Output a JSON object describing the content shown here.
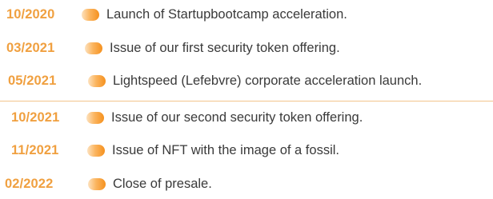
{
  "timeline": {
    "events": [
      {
        "date": "10/2020",
        "text": "Launch of Startupbootcamp acceleration."
      },
      {
        "date": "03/2021",
        "text": "Issue of our first security token offering."
      },
      {
        "date": "05/2021",
        "text": "Lightspeed (Lefebvre) corporate acceleration launch."
      },
      {
        "date": "10/2021",
        "text": "Issue of our second security token offering."
      },
      {
        "date": "11/2021",
        "text": "Issue of NFT with the image of a fossil."
      },
      {
        "date": "02/2022",
        "text": "Close of presale."
      }
    ]
  },
  "colors": {
    "date": "#f0a040",
    "marker": "#f5911e",
    "text": "#3a3a3a",
    "divider": "#f2c48c"
  }
}
